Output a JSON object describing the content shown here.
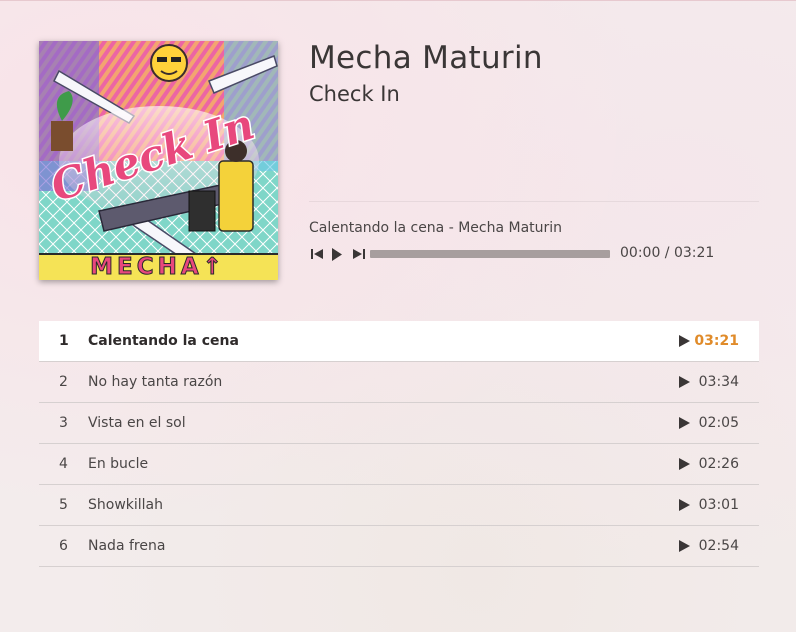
{
  "album": {
    "artist": "Mecha Maturin",
    "title": "Check In",
    "cover_text": "Check In",
    "cover_band_text": "MECHA↑"
  },
  "player": {
    "now_playing": "Calentando la cena - Mecha Maturin",
    "current_time": "00:00",
    "total_time": "03:21",
    "time_display": "00:00 / 03:21",
    "progress": 0,
    "prev_icon": "skip-previous-icon",
    "play_icon": "play-icon",
    "next_icon": "skip-next-icon"
  },
  "tracks": [
    {
      "number": "1",
      "title": "Calentando la cena",
      "duration": "03:21",
      "active": true
    },
    {
      "number": "2",
      "title": "No hay tanta razón",
      "duration": "03:34",
      "active": false
    },
    {
      "number": "3",
      "title": "Vista en el sol",
      "duration": "02:05",
      "active": false
    },
    {
      "number": "4",
      "title": "En bucle",
      "duration": "02:26",
      "active": false
    },
    {
      "number": "5",
      "title": "Showkillah",
      "duration": "03:01",
      "active": false
    },
    {
      "number": "6",
      "title": "Nada frena",
      "duration": "02:54",
      "active": false
    }
  ],
  "colors": {
    "accent": "#e08b2a",
    "progress_bar": "#a79e9e",
    "row_active_bg": "#ffffff",
    "row_divider": "#d6d0d0"
  }
}
